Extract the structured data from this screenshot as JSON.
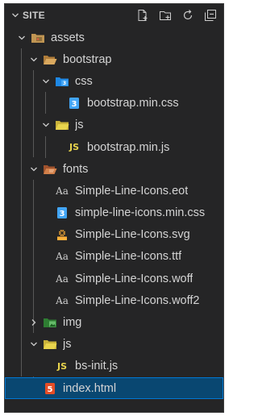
{
  "explorer": {
    "section_title": "SITE",
    "actions": [
      "new-file-icon",
      "new-folder-icon",
      "refresh-icon",
      "collapse-all-icon"
    ]
  },
  "tree": {
    "assets": "assets",
    "bootstrap": "bootstrap",
    "css": "css",
    "bootstrap_min_css": "bootstrap.min.css",
    "js": "js",
    "bootstrap_min_js": "bootstrap.min.js",
    "fonts": "fonts",
    "font_eot": "Simple-Line-Icons.eot",
    "font_min_css": "simple-line-icons.min.css",
    "font_svg": "Simple-Line-Icons.svg",
    "font_ttf": "Simple-Line-Icons.ttf",
    "font_woff": "Simple-Line-Icons.woff",
    "font_woff2": "Simple-Line-Icons.woff2",
    "img": "img",
    "js2": "js",
    "bs_init_js": "bs-init.js",
    "index_html": "index.html"
  },
  "icon_text": {
    "js_badge": "JS",
    "font_badge": "Aa"
  },
  "colors": {
    "folder": "#c09553",
    "css_blue": "#42a5f5",
    "js_yellow": "#e8d44d",
    "html_orange": "#e44d26",
    "img_green": "#4caf50",
    "selected_bg": "#094771"
  }
}
